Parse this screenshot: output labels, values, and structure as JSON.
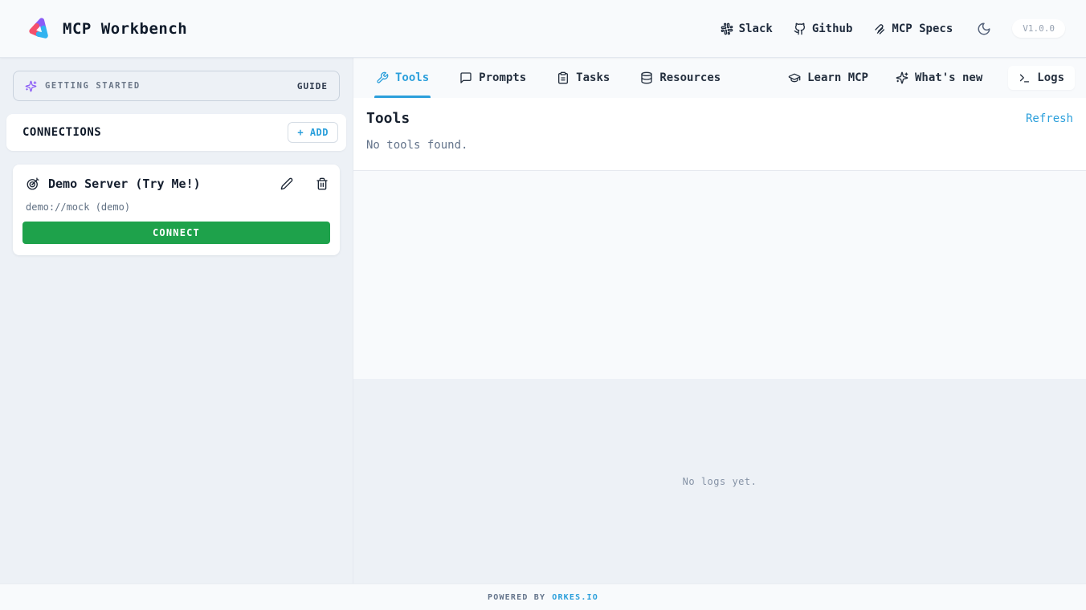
{
  "header": {
    "title": "MCP Workbench",
    "version": "V1.0.0",
    "nav": [
      {
        "label": "Slack",
        "icon": "slack-icon"
      },
      {
        "label": "Github",
        "icon": "github-icon"
      },
      {
        "label": "MCP Specs",
        "icon": "mcp-specs-icon"
      }
    ],
    "theme_toggle_icon": "moon-icon"
  },
  "sidebar": {
    "getting_started": {
      "label": "GETTING STARTED",
      "action": "GUIDE",
      "icon": "sparkles-icon"
    },
    "connections": {
      "title": "CONNECTIONS",
      "add_button": "+ ADD"
    },
    "server": {
      "name": "Demo Server (Try Me!)",
      "url": "demo://mock (demo)",
      "connect_button": "CONNECT",
      "icon": "target-dart-icon"
    }
  },
  "tabs": {
    "left": [
      {
        "label": "Tools",
        "icon": "wrench-icon",
        "active": true
      },
      {
        "label": "Prompts",
        "icon": "message-square-icon",
        "active": false
      },
      {
        "label": "Tasks",
        "icon": "clipboard-icon",
        "active": false
      },
      {
        "label": "Resources",
        "icon": "database-icon",
        "active": false
      }
    ],
    "right": [
      {
        "label": "Learn MCP",
        "icon": "graduation-cap-icon"
      },
      {
        "label": "What's new",
        "icon": "sparkles-icon"
      },
      {
        "label": "Logs",
        "icon": "terminal-icon"
      }
    ]
  },
  "tools_panel": {
    "title": "Tools",
    "refresh_label": "Refresh",
    "empty_message": "No tools found."
  },
  "logs_panel": {
    "empty_message": "No logs yet."
  },
  "footer": {
    "powered_by": "POWERED BY",
    "link": "ORKES.IO"
  },
  "colors": {
    "accent_blue": "#2b9fdb",
    "connect_green": "#1ea24b",
    "sparkle_purple": "#8b5cf6",
    "header_bg": "#f8fafc",
    "sidebar_bg": "#edf1f6",
    "panel_white": "#ffffff"
  }
}
